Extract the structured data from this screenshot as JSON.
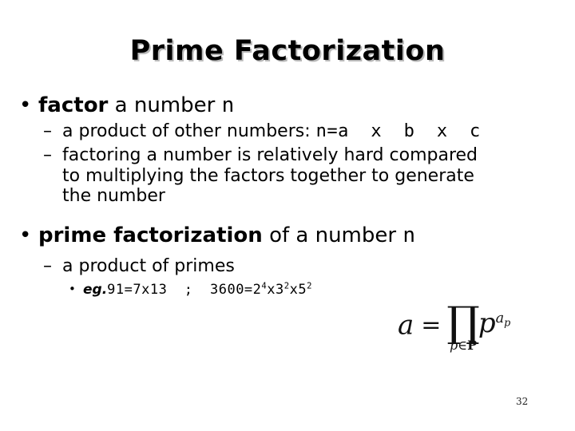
{
  "slide": {
    "title": "Prime Factorization",
    "page_number": "32",
    "background_color": "#ffffff",
    "text_color": "#000000",
    "title_shadow_color": "#b8b8b8"
  },
  "bullets": {
    "level1_marker": "•",
    "level2_marker": "–",
    "level3_marker": "•",
    "b1": {
      "bold": "factor",
      "plain": " a number ",
      "mono": "n"
    },
    "b1s1": {
      "plain": "a product of other numbers: ",
      "mono": "n=a  x  b  x  c"
    },
    "b1s2": {
      "line1": "factoring a number is relatively hard compared",
      "line2": "to multiplying the factors together to generate",
      "line3": "the number"
    },
    "b2": {
      "bold": "prime factorization",
      "plain": " of a number ",
      "mono": "n"
    },
    "b2s1": {
      "plain": "a product of primes"
    },
    "b2s1e1": {
      "bold_italic": "eg.",
      "mono_a": "91=7x13  ;  3600=2",
      "sup_a": "4",
      "mono_b": "x3",
      "sup_b": "2",
      "mono_c": "x5",
      "sup_c": "2"
    }
  },
  "equation": {
    "lhs": "a",
    "equals": "=",
    "product_symbol": "∏",
    "subscript_var": "p",
    "subscript_in": "∈",
    "subscript_set": "P",
    "base": "p",
    "exponent": "a",
    "exponent_sub": "p",
    "latex": "a = \\prod_{p \\in P} p^{a_p}"
  }
}
